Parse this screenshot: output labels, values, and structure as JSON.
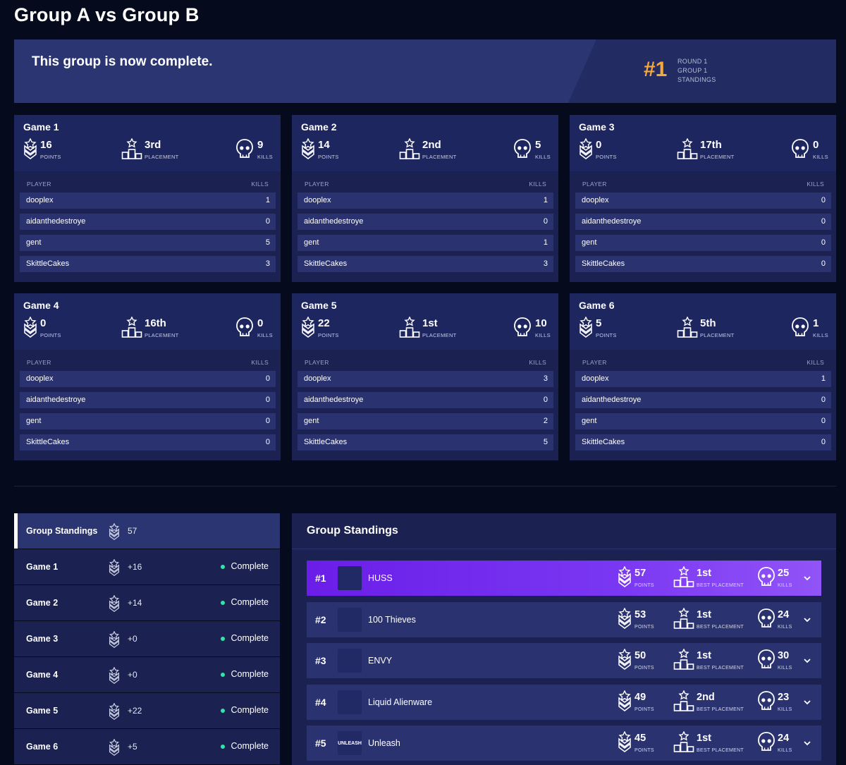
{
  "page": {
    "title": "Group A vs Group B"
  },
  "banner": {
    "message": "This group is now complete.",
    "rank": "#1",
    "meta": [
      "ROUND 1",
      "GROUP 1",
      "STANDINGS"
    ]
  },
  "labels": {
    "points": "POINTS",
    "placement": "PLACEMENT",
    "kills": "KILLS",
    "player": "PLAYER",
    "best_placement": "BEST PLACEMENT"
  },
  "games": [
    {
      "title": "Game 1",
      "points": "16",
      "placement": "3rd",
      "kills": "9",
      "players": [
        {
          "name": "dooplex",
          "kills": "1"
        },
        {
          "name": "aidanthedestroye",
          "kills": "0"
        },
        {
          "name": "gent",
          "kills": "5"
        },
        {
          "name": "SkittleCakes",
          "kills": "3"
        }
      ]
    },
    {
      "title": "Game 2",
      "points": "14",
      "placement": "2nd",
      "kills": "5",
      "players": [
        {
          "name": "dooplex",
          "kills": "1"
        },
        {
          "name": "aidanthedestroye",
          "kills": "0"
        },
        {
          "name": "gent",
          "kills": "1"
        },
        {
          "name": "SkittleCakes",
          "kills": "3"
        }
      ]
    },
    {
      "title": "Game 3",
      "points": "0",
      "placement": "17th",
      "kills": "0",
      "players": [
        {
          "name": "dooplex",
          "kills": "0"
        },
        {
          "name": "aidanthedestroye",
          "kills": "0"
        },
        {
          "name": "gent",
          "kills": "0"
        },
        {
          "name": "SkittleCakes",
          "kills": "0"
        }
      ]
    },
    {
      "title": "Game 4",
      "points": "0",
      "placement": "16th",
      "kills": "0",
      "players": [
        {
          "name": "dooplex",
          "kills": "0"
        },
        {
          "name": "aidanthedestroye",
          "kills": "0"
        },
        {
          "name": "gent",
          "kills": "0"
        },
        {
          "name": "SkittleCakes",
          "kills": "0"
        }
      ]
    },
    {
      "title": "Game 5",
      "points": "22",
      "placement": "1st",
      "kills": "10",
      "players": [
        {
          "name": "dooplex",
          "kills": "3"
        },
        {
          "name": "aidanthedestroye",
          "kills": "0"
        },
        {
          "name": "gent",
          "kills": "2"
        },
        {
          "name": "SkittleCakes",
          "kills": "5"
        }
      ]
    },
    {
      "title": "Game 6",
      "points": "5",
      "placement": "5th",
      "kills": "1",
      "players": [
        {
          "name": "dooplex",
          "kills": "1"
        },
        {
          "name": "aidanthedestroye",
          "kills": "0"
        },
        {
          "name": "gent",
          "kills": "0"
        },
        {
          "name": "SkittleCakes",
          "kills": "0"
        }
      ]
    }
  ],
  "left_list": {
    "summary": {
      "label": "Group Standings",
      "points": "57"
    },
    "items": [
      {
        "label": "Game 1",
        "points": "+16",
        "status": "Complete"
      },
      {
        "label": "Game 2",
        "points": "+14",
        "status": "Complete"
      },
      {
        "label": "Game 3",
        "points": "+0",
        "status": "Complete"
      },
      {
        "label": "Game 4",
        "points": "+0",
        "status": "Complete"
      },
      {
        "label": "Game 5",
        "points": "+22",
        "status": "Complete"
      },
      {
        "label": "Game 6",
        "points": "+5",
        "status": "Complete"
      }
    ]
  },
  "standings": {
    "title": "Group Standings",
    "teams": [
      {
        "rank": "#1",
        "name": "HUSS",
        "logo": "",
        "points": "57",
        "best_placement": "1st",
        "kills": "25"
      },
      {
        "rank": "#2",
        "name": "100 Thieves",
        "logo": "",
        "points": "53",
        "best_placement": "1st",
        "kills": "24"
      },
      {
        "rank": "#3",
        "name": "ENVY",
        "logo": "",
        "points": "50",
        "best_placement": "1st",
        "kills": "30"
      },
      {
        "rank": "#4",
        "name": "Liquid Alienware",
        "logo": "",
        "points": "49",
        "best_placement": "2nd",
        "kills": "23"
      },
      {
        "rank": "#5",
        "name": "Unleash",
        "logo": "UNLEASH",
        "points": "45",
        "best_placement": "1st",
        "kills": "24"
      }
    ]
  },
  "colors": {
    "accent": "#f6a93b",
    "complete_dot": "#2ee6a6",
    "highlight": "#7a37f2"
  }
}
